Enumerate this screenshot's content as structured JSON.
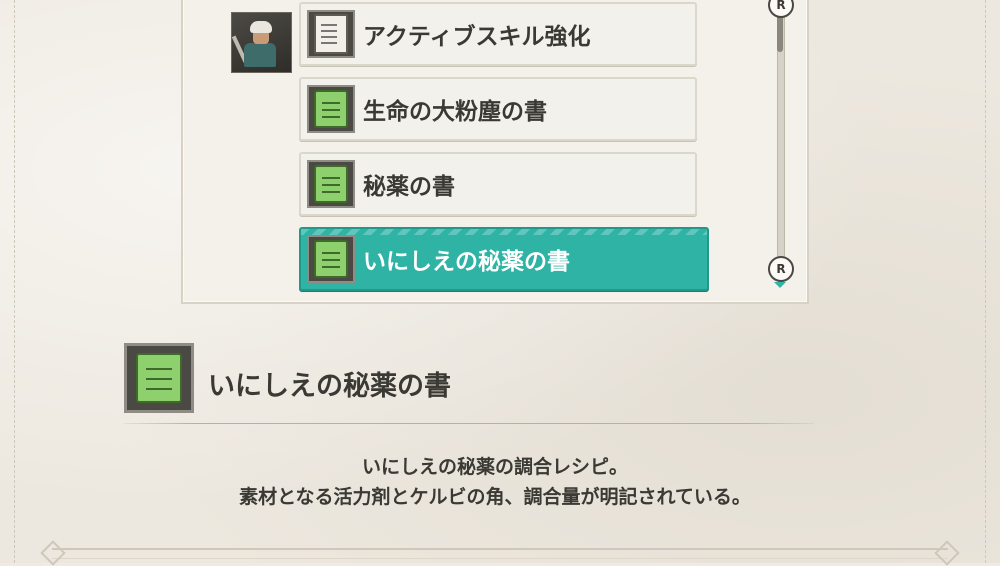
{
  "list": {
    "items": [
      {
        "label": "アクティブスキル強化",
        "icon": "scroll-paper-icon",
        "selected": false
      },
      {
        "label": "生命の大粉塵の書",
        "icon": "green-scroll-icon",
        "selected": false
      },
      {
        "label": "秘薬の書",
        "icon": "green-scroll-icon",
        "selected": false
      },
      {
        "label": "いにしえの秘薬の書",
        "icon": "green-scroll-icon",
        "selected": true
      }
    ],
    "scroll_badge_top": "R",
    "scroll_badge_bottom": "R"
  },
  "detail": {
    "title": "いにしえの秘薬の書",
    "description_line1": "いにしえの秘薬の調合レシピ。",
    "description_line2": "素材となる活力剤とケルビの角、調合量が明記されている。"
  },
  "colors": {
    "selected": "#2fb3a5",
    "icon_green": "#8fd06e",
    "background": "#ede8df"
  }
}
